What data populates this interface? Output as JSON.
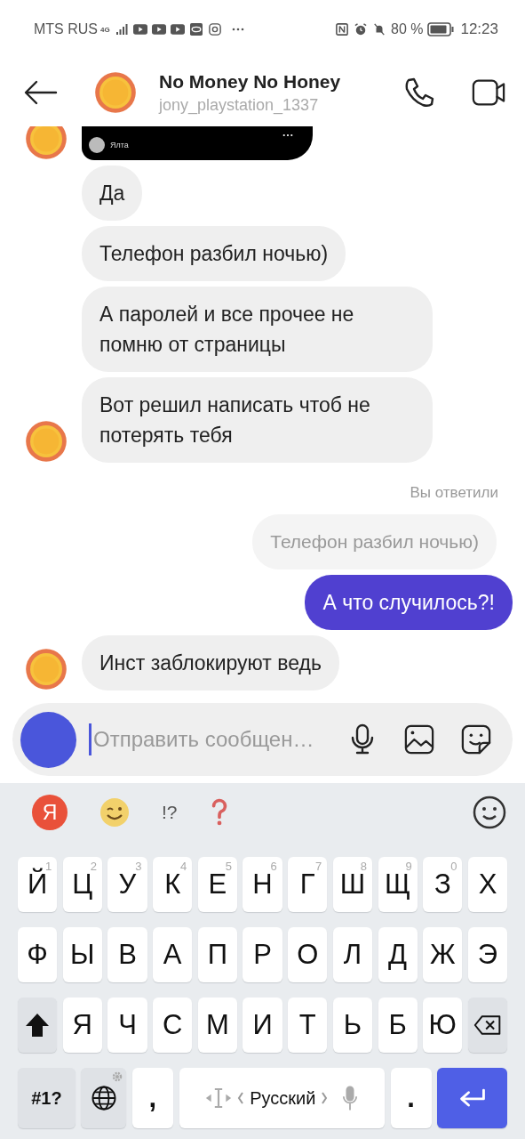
{
  "status_bar": {
    "carrier": "MTS RUS",
    "network": "4G",
    "battery": "80 %",
    "time": "12:23"
  },
  "header": {
    "title": "No Money No Honey",
    "subtitle": "jony_playstation_1337"
  },
  "messages": [
    {
      "kind": "post",
      "outgoing": false,
      "avatar": true,
      "caption": "Ялта"
    },
    {
      "kind": "text",
      "outgoing": false,
      "avatar": false,
      "text": "Да"
    },
    {
      "kind": "text",
      "outgoing": false,
      "avatar": false,
      "text": "Телефон разбил ночью)"
    },
    {
      "kind": "text",
      "outgoing": false,
      "avatar": false,
      "text": "А паролей и все прочее не помню от страницы"
    },
    {
      "kind": "text",
      "outgoing": false,
      "avatar": true,
      "text": "Вот решил написать чтоб не потерять тебя"
    },
    {
      "kind": "reply_label",
      "outgoing": true,
      "text": "Вы ответили"
    },
    {
      "kind": "quote",
      "outgoing": true,
      "text": "Телефон разбил ночью)"
    },
    {
      "kind": "text",
      "outgoing": true,
      "text": "А что случилось?!"
    },
    {
      "kind": "text",
      "outgoing": false,
      "avatar": true,
      "text": "Инст заблокируют ведь"
    }
  ],
  "composer": {
    "placeholder": "Отправить сообщен…",
    "focused": true
  },
  "keyboard": {
    "suggestions": [
      {
        "kind": "yandex",
        "label": "Я"
      },
      {
        "kind": "wink"
      },
      {
        "kind": "text",
        "label": "!?"
      },
      {
        "kind": "question"
      }
    ],
    "rows": [
      [
        {
          "label": "Й",
          "hint": "1"
        },
        {
          "label": "Ц",
          "hint": "2"
        },
        {
          "label": "У",
          "hint": "3"
        },
        {
          "label": "К",
          "hint": "4"
        },
        {
          "label": "Е",
          "hint": "5"
        },
        {
          "label": "Н",
          "hint": "6"
        },
        {
          "label": "Г",
          "hint": "7"
        },
        {
          "label": "Ш",
          "hint": "8"
        },
        {
          "label": "Щ",
          "hint": "9"
        },
        {
          "label": "З",
          "hint": "0"
        },
        {
          "label": "Х"
        }
      ],
      [
        {
          "label": "Ф"
        },
        {
          "label": "Ы"
        },
        {
          "label": "В"
        },
        {
          "label": "А"
        },
        {
          "label": "П"
        },
        {
          "label": "Р"
        },
        {
          "label": "О"
        },
        {
          "label": "Л"
        },
        {
          "label": "Д"
        },
        {
          "label": "Ж"
        },
        {
          "label": "Э"
        }
      ],
      [
        {
          "kind": "shift"
        },
        {
          "label": "Я"
        },
        {
          "label": "Ч"
        },
        {
          "label": "С"
        },
        {
          "label": "М"
        },
        {
          "label": "И"
        },
        {
          "label": "Т"
        },
        {
          "label": "Ь"
        },
        {
          "label": "Б"
        },
        {
          "label": "Ю"
        },
        {
          "kind": "backspace"
        }
      ]
    ],
    "bottom_bar": [
      {
        "kind": "symbols",
        "label": "#1?"
      },
      {
        "kind": "globe"
      },
      {
        "label": ","
      },
      {
        "kind": "space",
        "label": "Русский"
      },
      {
        "label": "."
      },
      {
        "kind": "enter"
      }
    ]
  }
}
